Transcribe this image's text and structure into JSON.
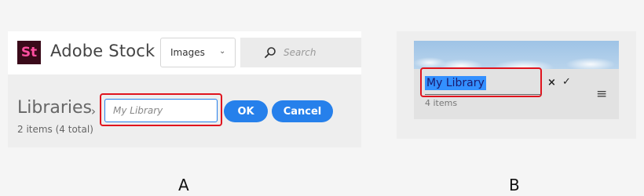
{
  "panel_a": {
    "logo_text": "St",
    "brand": "Adobe Stock",
    "type_select": {
      "selected": "Images"
    },
    "search_placeholder": "Search",
    "libraries_title": "Libraries",
    "breadcrumb_arrow": "›",
    "item_count": "2 items (4 total)",
    "name_input_placeholder": "My Library",
    "ok_label": "OK",
    "cancel_label": "Cancel"
  },
  "panel_b": {
    "name_value": "My Library",
    "close_glyph": "×",
    "confirm_glyph": "✓",
    "menu_glyph": "≡",
    "item_count": "4 items"
  },
  "captions": {
    "a": "A",
    "b": "B"
  },
  "colors": {
    "accent_blue": "#2680eb",
    "highlight_red": "#e0141e",
    "logo_bg": "#3a0a1a",
    "logo_fg": "#ff4fa0",
    "selection_blue": "#3390ff"
  }
}
